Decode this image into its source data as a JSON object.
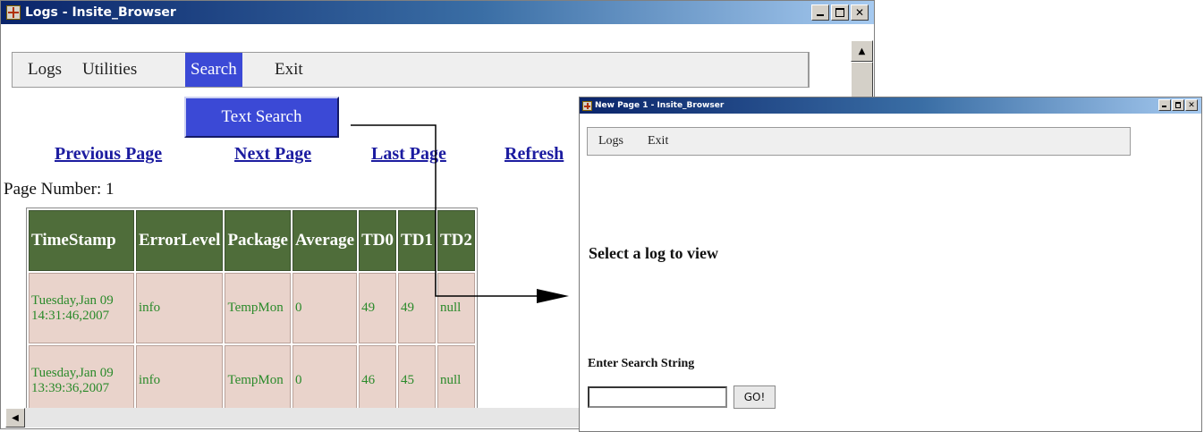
{
  "main_window": {
    "title": "Logs - Insite_Browser",
    "menu": [
      "Logs",
      "Utilities",
      "Search",
      "Exit"
    ],
    "active_menu": "Search",
    "dropdown_items": [
      "Text Search"
    ],
    "nav_links": [
      "Previous Page",
      "Next Page",
      "Last Page",
      "Refresh"
    ],
    "page_number_label": "Page Number: 1",
    "table": {
      "headers": [
        "TimeStamp",
        "ErrorLevel",
        "Package",
        "Average",
        "TD0",
        "TD1",
        "TD2"
      ],
      "rows": [
        [
          "Tuesday,Jan 09 14:31:46,2007",
          "info",
          "TempMon",
          "0",
          "49",
          "49",
          "null"
        ],
        [
          "Tuesday,Jan 09 13:39:36,2007",
          "info",
          "TempMon",
          "0",
          "46",
          "45",
          "null"
        ]
      ]
    }
  },
  "secondary_window": {
    "title": "New Page 1 - Insite_Browser",
    "menu": [
      "Logs",
      "Exit"
    ],
    "heading": "Select a log to view",
    "search_label": "Enter Search String",
    "search_value": "",
    "go_label": "GO!"
  },
  "colors": {
    "titlebar_start": "#0a246a",
    "menu_highlight": "#3b49d6",
    "table_header_bg": "#4f6d3a",
    "table_cell_bg": "#e9d3cb",
    "cell_text": "#2a8a2a",
    "link": "#1c1ca0"
  },
  "icons": [
    "app-icon",
    "minimize-icon",
    "maximize-icon",
    "close-icon",
    "scroll-up-icon",
    "scroll-left-icon",
    "arrow-icon"
  ]
}
